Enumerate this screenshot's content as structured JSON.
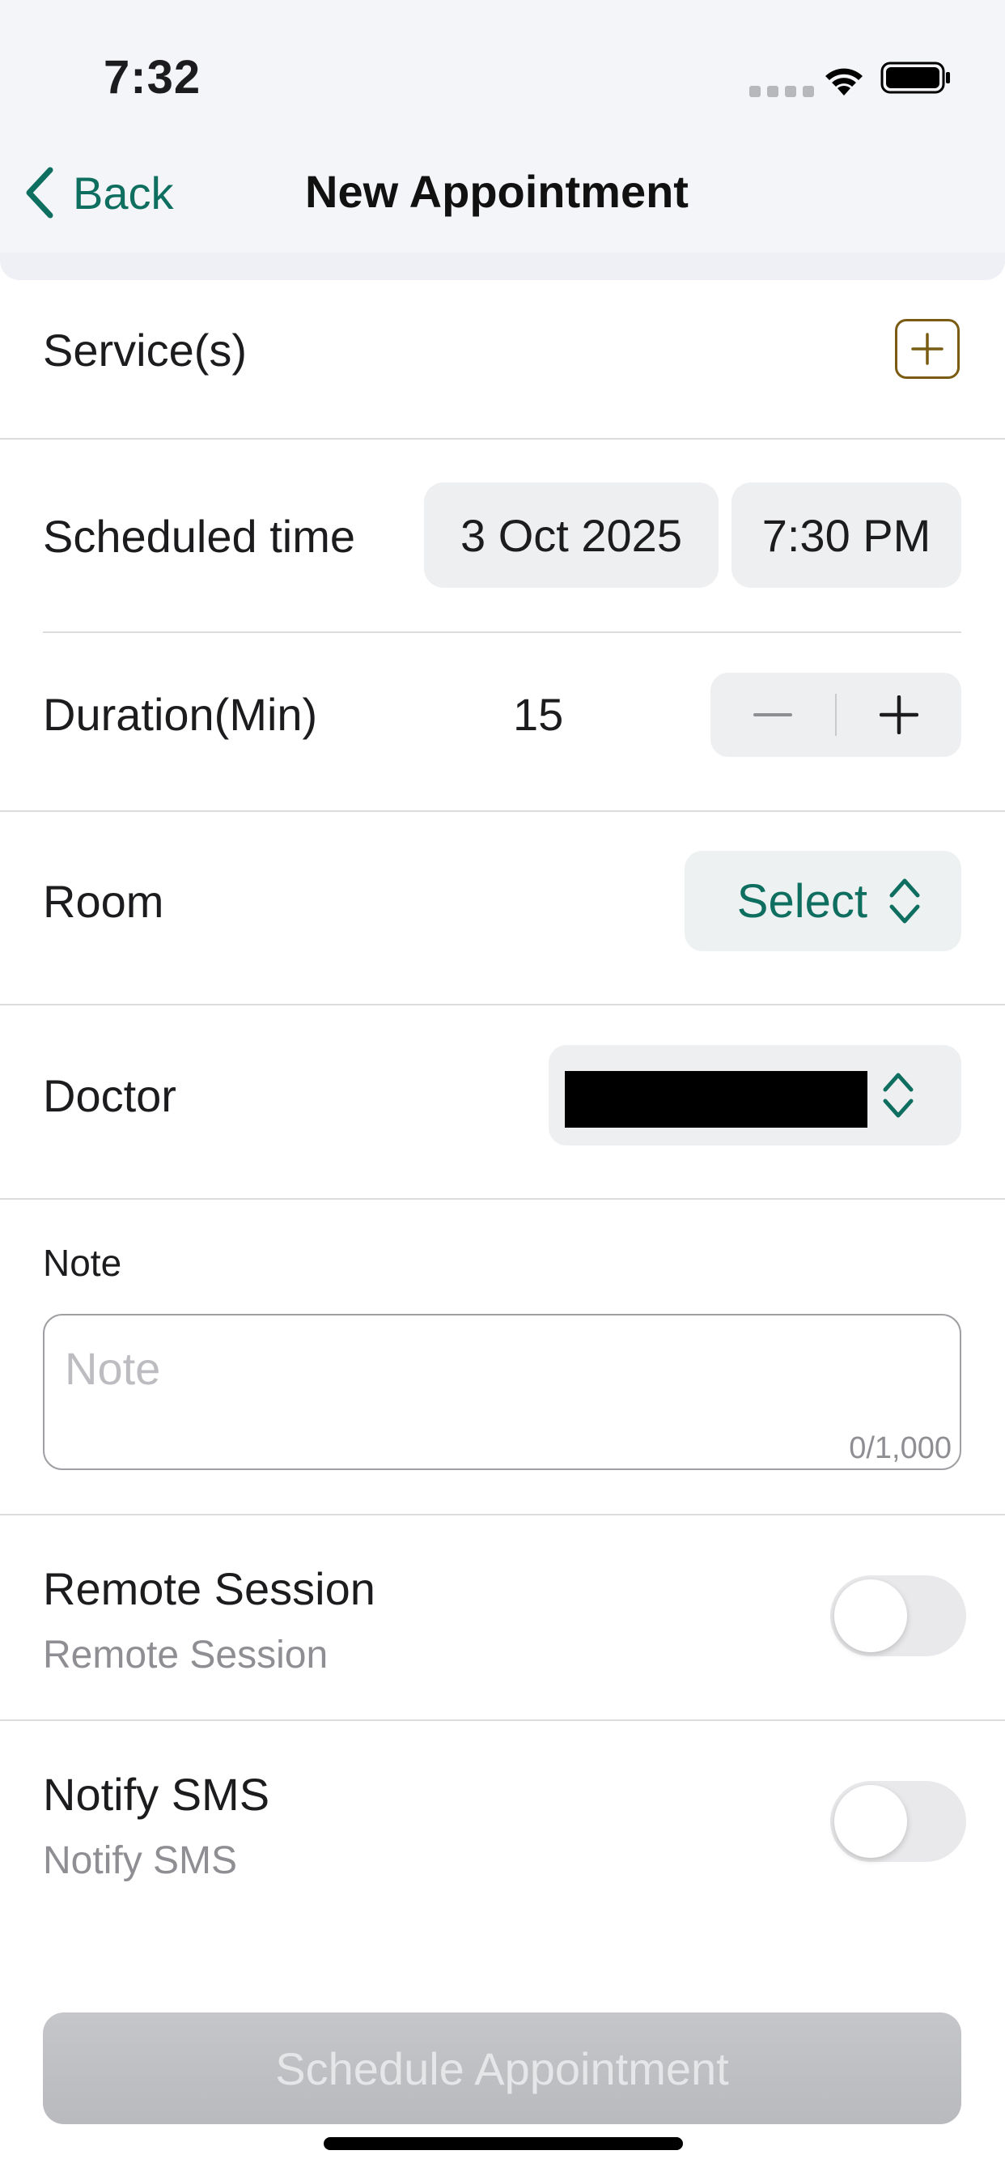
{
  "status_bar": {
    "time": "7:32"
  },
  "nav": {
    "back_label": "Back",
    "title": "New Appointment"
  },
  "services": {
    "label": "Service(s)"
  },
  "schedule": {
    "label": "Scheduled time",
    "date": "3 Oct 2025",
    "time": "7:30 PM"
  },
  "duration": {
    "label": "Duration(Min)",
    "value": "15"
  },
  "room": {
    "label": "Room",
    "select_label": "Select"
  },
  "doctor": {
    "label": "Doctor"
  },
  "note": {
    "label": "Note",
    "placeholder": "Note",
    "counter": "0/1,000"
  },
  "remote_session": {
    "title": "Remote Session",
    "subtitle": "Remote Session",
    "enabled": false
  },
  "notify_sms": {
    "title": "Notify SMS",
    "subtitle": "Notify SMS",
    "enabled": false
  },
  "cta": {
    "label": "Schedule Appointment"
  },
  "colors": {
    "accent": "#0e6e5f",
    "add_button": "#7a5b12",
    "pill_bg": "#eeeff1"
  },
  "icons": [
    "chevron-left-icon",
    "plus-square-icon",
    "minus-icon",
    "plus-icon",
    "up-down-chevron-icon",
    "wifi-icon",
    "battery-icon",
    "cellular-signal-icon"
  ]
}
